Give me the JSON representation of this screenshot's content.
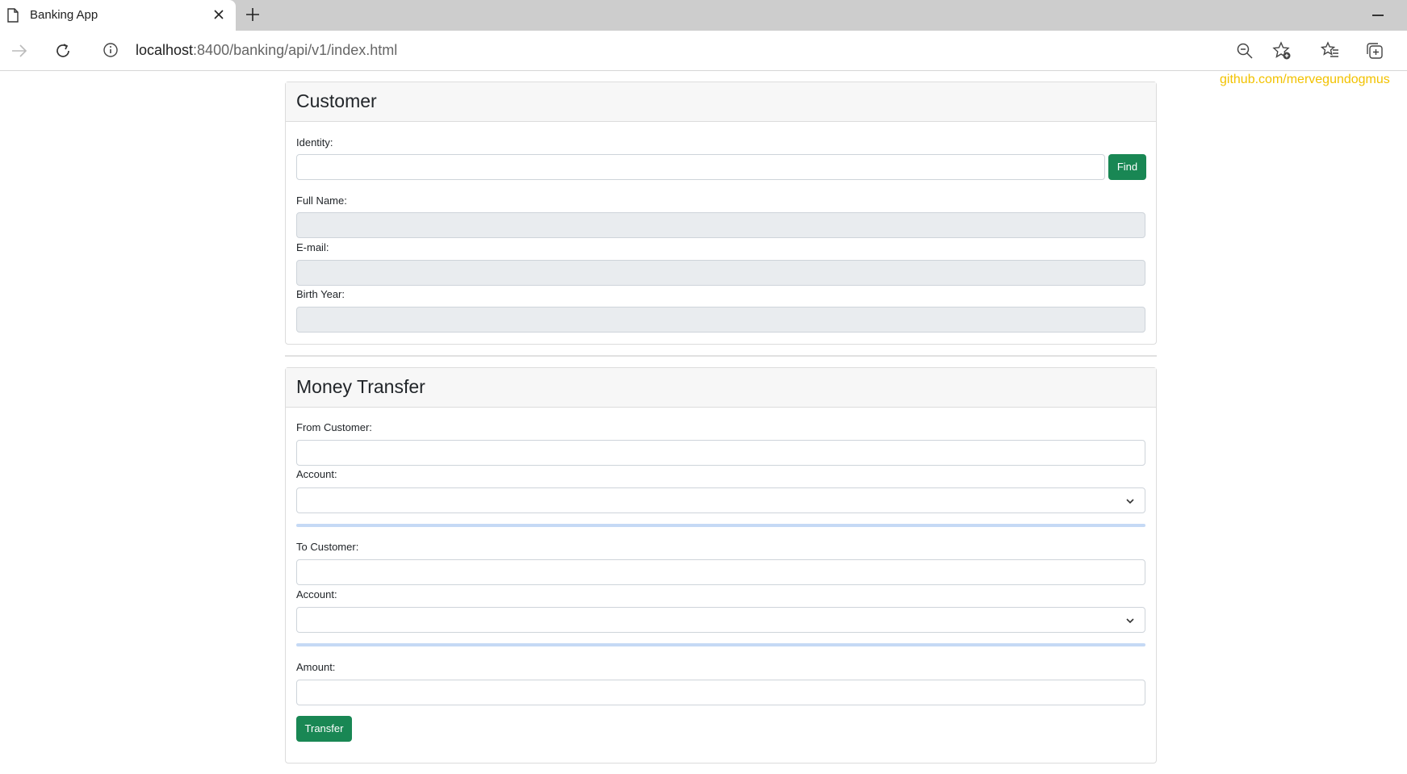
{
  "browser": {
    "tab_title": "Banking App",
    "url_host": "localhost",
    "url_rest": ":8400/banking/api/v1/index.html",
    "icons": [
      "page-icon",
      "close-icon",
      "plus-icon",
      "back-arrow-icon",
      "refresh-icon",
      "info-icon",
      "zoom-out-icon",
      "add-favorite-icon",
      "favorites-icon",
      "collections-icon",
      "minimize-icon"
    ]
  },
  "watermark": "github.com/mervegundogmus",
  "customer": {
    "title": "Customer",
    "identity_label": "Identity:",
    "identity_value": "",
    "find_label": "Find",
    "fullname_label": "Full Name:",
    "email_label": "E-mail:",
    "birthyear_label": "Birth Year:"
  },
  "transfer": {
    "title": "Money Transfer",
    "from_label": "From Customer:",
    "from_account_label": "Account:",
    "to_label": "To Customer:",
    "to_account_label": "Account:",
    "amount_label": "Amount:",
    "transfer_label": "Transfer"
  },
  "colors": {
    "button": "#198754",
    "watermark": "#f2c200",
    "progress": "#c5d9f5"
  }
}
